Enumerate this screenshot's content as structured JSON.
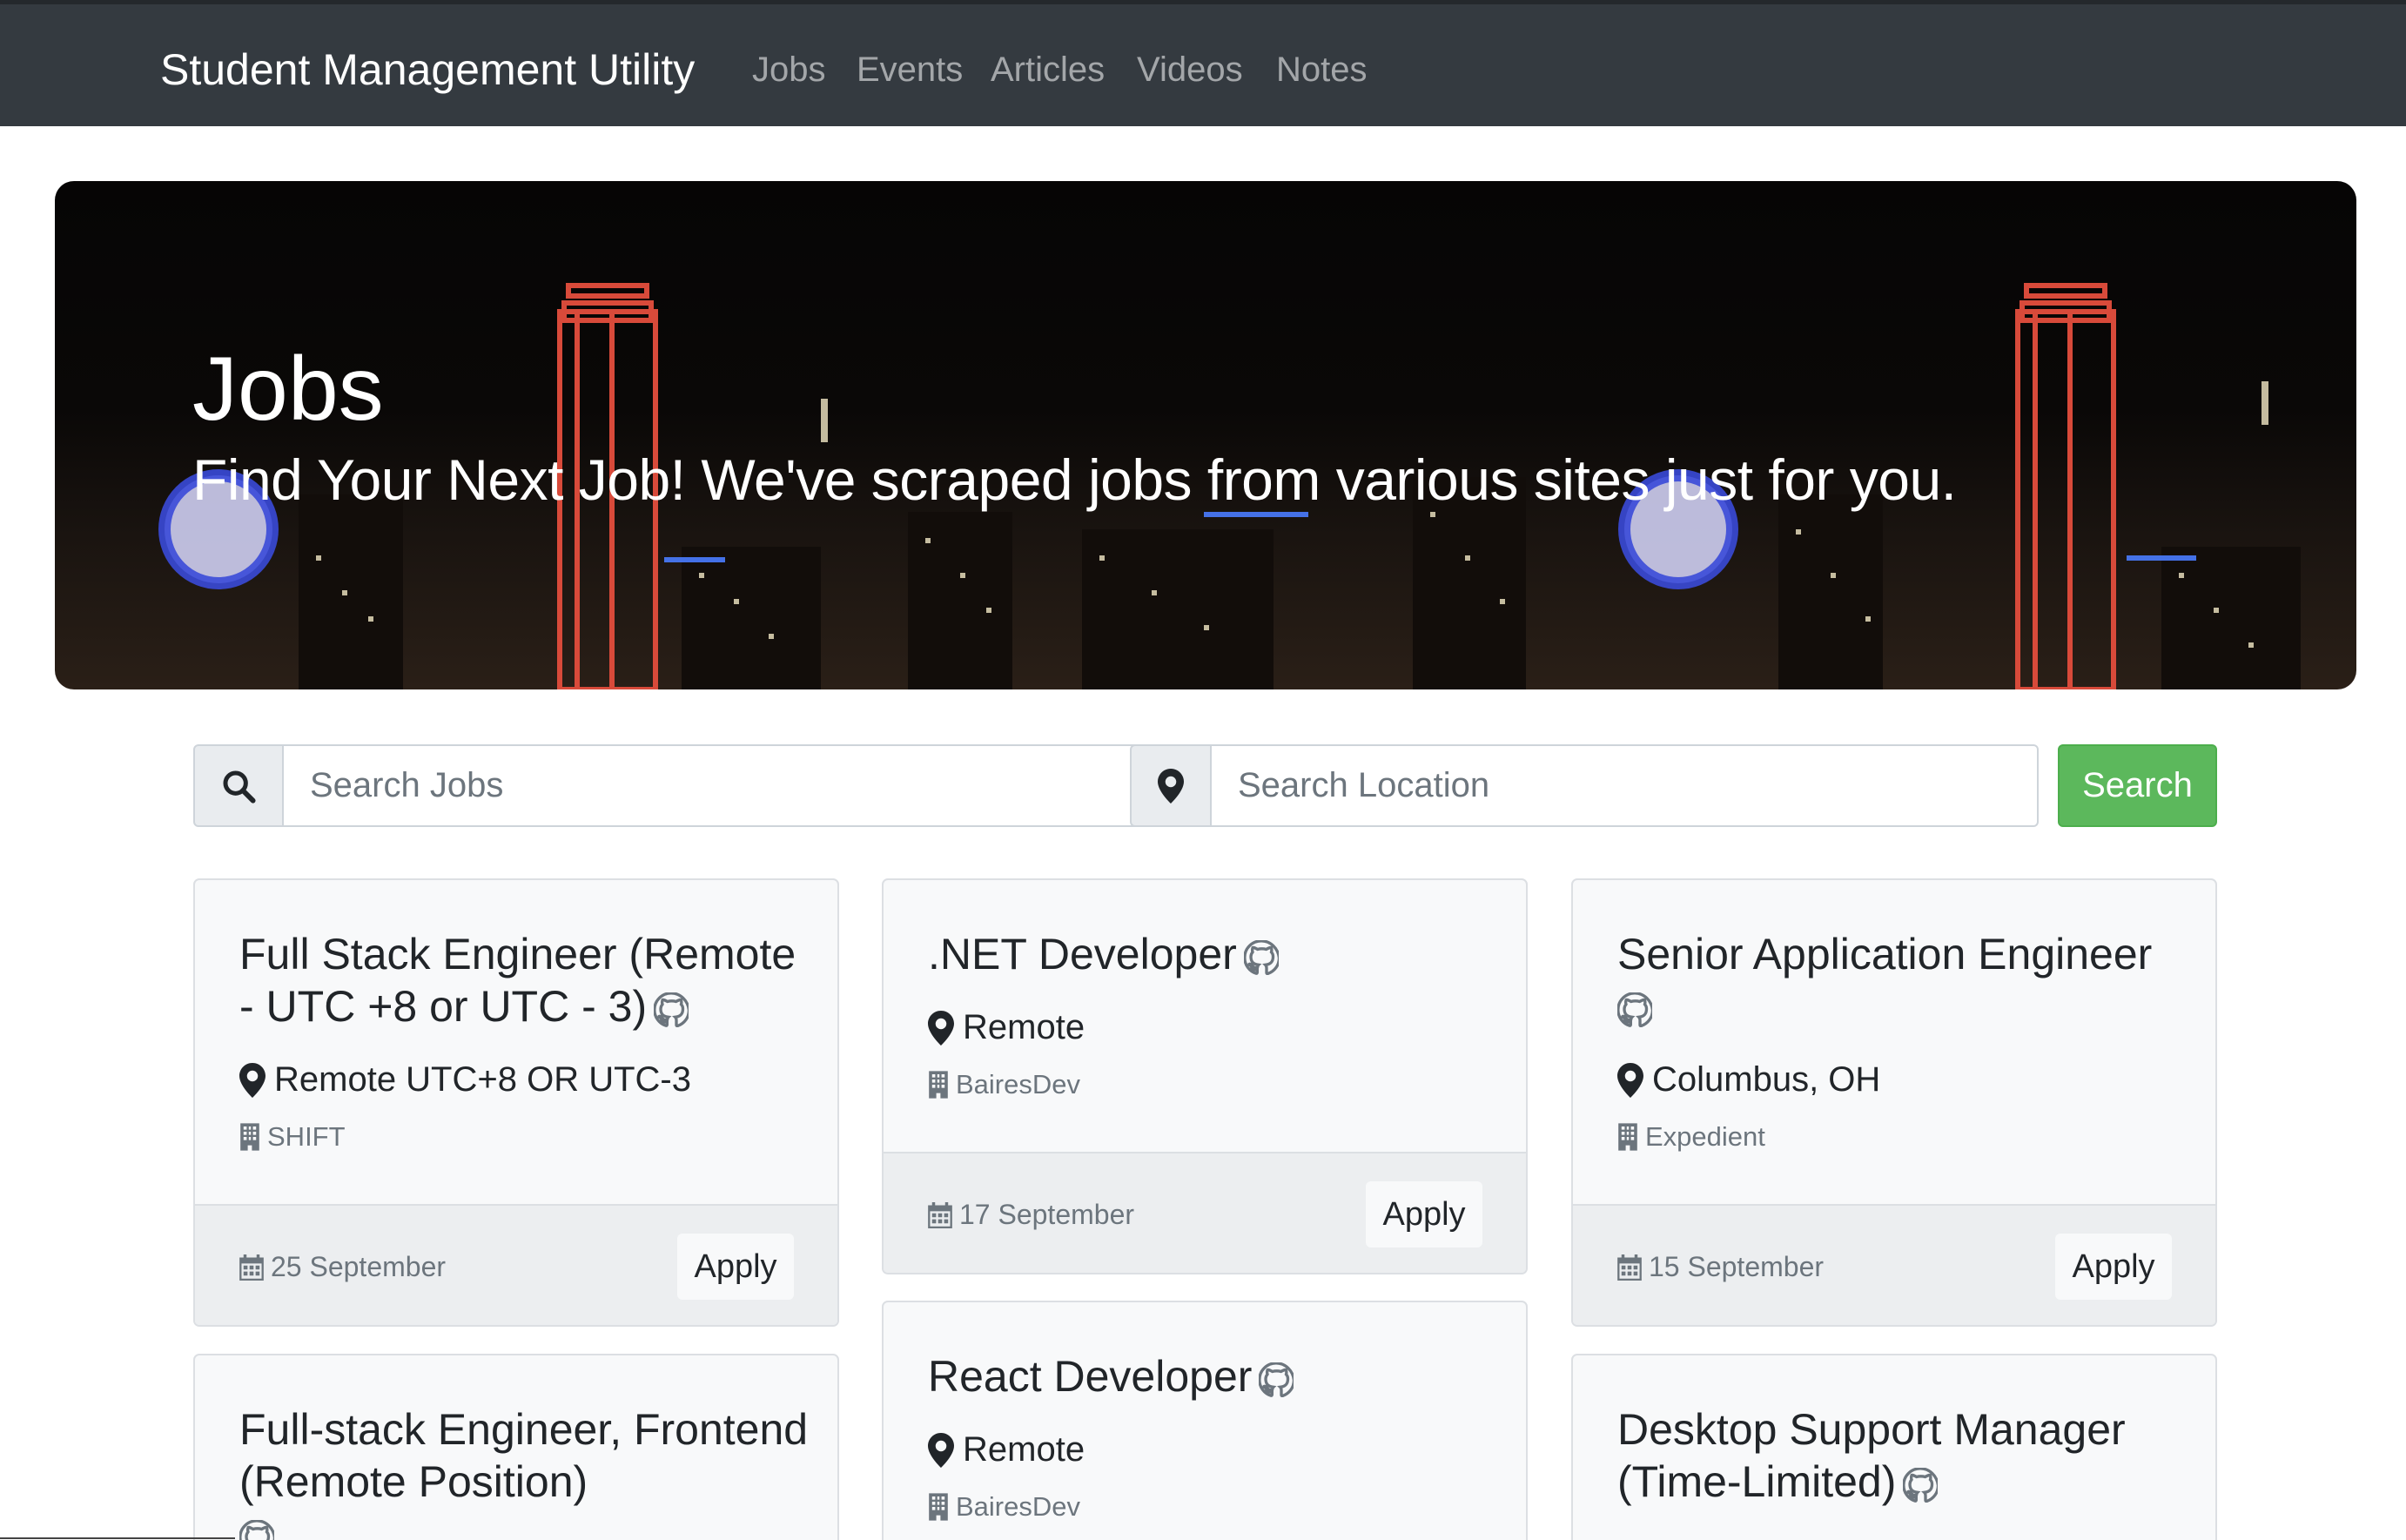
{
  "navbar": {
    "brand": "Student Management Utility",
    "links": [
      "Jobs",
      "Events",
      "Articles",
      "Videos",
      "Notes"
    ]
  },
  "hero": {
    "title": "Jobs",
    "subtitle": "Find Your Next Job! We've scraped jobs from various sites just for you."
  },
  "search": {
    "jobs_placeholder": "Search Jobs",
    "location_placeholder": "Search Location",
    "button_label": "Search",
    "button_color": "#5cb85c"
  },
  "jobs": [
    {
      "title": "Full Stack Engineer (Remote - UTC +8 or UTC - 3)",
      "location": "Remote UTC+8 OR UTC-3",
      "company": "SHIFT",
      "date": "25 September",
      "apply_label": "Apply"
    },
    {
      "title": ".NET Developer",
      "location": "Remote",
      "company": "BairesDev",
      "date": "17 September",
      "apply_label": "Apply"
    },
    {
      "title": "Senior Application Engineer",
      "location": "Columbus, OH",
      "company": "Expedient",
      "date": "15 September",
      "apply_label": "Apply"
    },
    {
      "title": "Full-stack Engineer, Frontend (Remote Position)"
    },
    {
      "title": "React Developer",
      "location": "Remote",
      "company": "BairesDev"
    },
    {
      "title": "Desktop Support Manager (Time-Limited)"
    }
  ],
  "icons": {
    "search": "search-icon",
    "location": "map-marker-icon",
    "company": "building-icon",
    "date": "calendar-icon",
    "source": "github-icon"
  }
}
